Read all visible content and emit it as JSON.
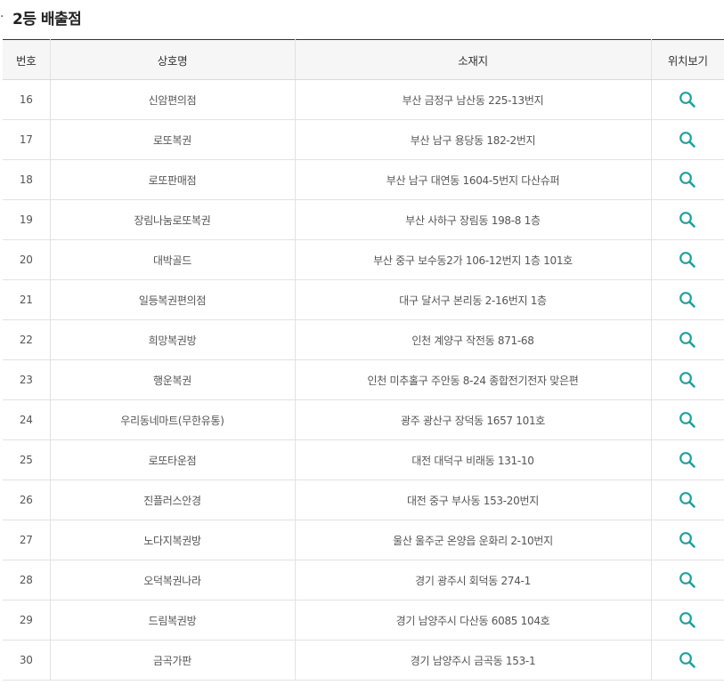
{
  "section": {
    "bullet": "·",
    "title": "2등 배출점"
  },
  "table": {
    "headers": {
      "no": "번호",
      "name": "상호명",
      "address": "소재지",
      "location": "위치보기"
    },
    "rows": [
      {
        "no": "16",
        "name": "신암편의점",
        "address": "부산 금정구 남산동 225-13번지"
      },
      {
        "no": "17",
        "name": "로또복권",
        "address": "부산 남구 용당동 182-2번지"
      },
      {
        "no": "18",
        "name": "로또판매점",
        "address": "부산 남구 대연동 1604-5번지 다산슈퍼"
      },
      {
        "no": "19",
        "name": "장림나눔로또복권",
        "address": "부산 사하구 장림동 198-8 1층"
      },
      {
        "no": "20",
        "name": "대박골드",
        "address": "부산 중구 보수동2가 106-12번지 1층 101호"
      },
      {
        "no": "21",
        "name": "일등복권편의점",
        "address": "대구 달서구 본리동 2-16번지 1층"
      },
      {
        "no": "22",
        "name": "희망복권방",
        "address": "인천 계양구 작전동 871-68"
      },
      {
        "no": "23",
        "name": "행운복권",
        "address": "인천 미추홀구 주안동 8-24 종합전기전자 맞은편"
      },
      {
        "no": "24",
        "name": "우리동네마트(무한유통)",
        "address": "광주 광산구 장덕동 1657 101호"
      },
      {
        "no": "25",
        "name": "로또타운점",
        "address": "대전 대덕구 비래동 131-10"
      },
      {
        "no": "26",
        "name": "진플러스안경",
        "address": "대전 중구 부사동 153-20번지"
      },
      {
        "no": "27",
        "name": "노다지복권방",
        "address": "울산 울주군 온양읍 운화리 2-10번지"
      },
      {
        "no": "28",
        "name": "오덕복권나라",
        "address": "경기 광주시 회덕동 274-1"
      },
      {
        "no": "29",
        "name": "드림복권방",
        "address": "경기 남양주시 다산동 6085 104호"
      },
      {
        "no": "30",
        "name": "금곡가판",
        "address": "경기 남양주시 금곡동 153-1"
      }
    ]
  },
  "icons": {
    "location": "search-icon"
  },
  "colors": {
    "accent": "#1ba39c",
    "header_bg": "#f6f6f6",
    "top_border": "#333333"
  }
}
